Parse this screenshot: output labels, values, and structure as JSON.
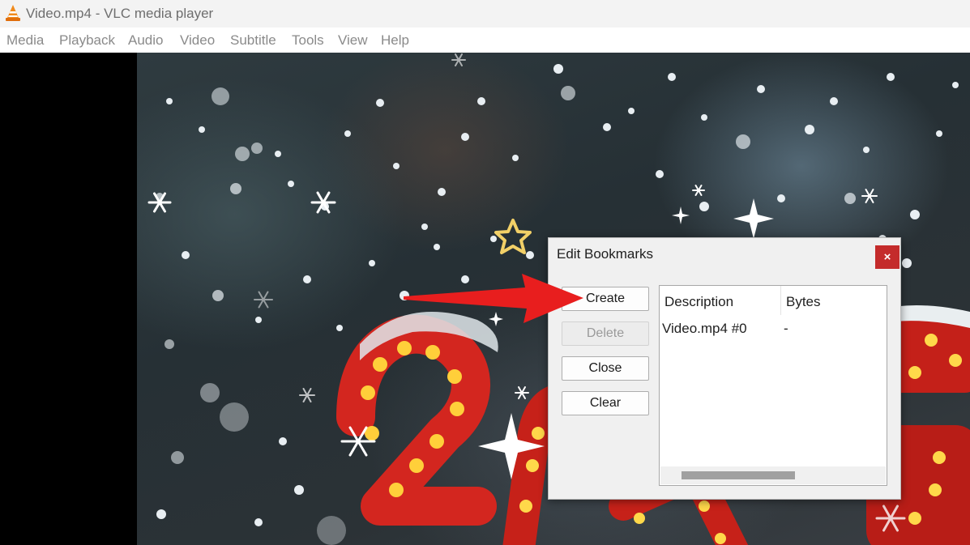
{
  "window": {
    "title": "Video.mp4 - VLC media player",
    "icon": "vlc-cone-icon"
  },
  "menubar": {
    "items": [
      "Media",
      "Playback",
      "Audio",
      "Video",
      "Subtitle",
      "Tools",
      "View",
      "Help"
    ]
  },
  "dialog": {
    "title": "Edit Bookmarks",
    "close_label": "×",
    "buttons": {
      "create": "Create",
      "delete": "Delete",
      "close": "Close",
      "clear": "Clear"
    },
    "table": {
      "headers": [
        "Description",
        "Bytes"
      ],
      "rows": [
        [
          "Video.mp4 #0",
          "-"
        ]
      ]
    }
  },
  "colors": {
    "close_button": "#c42b2b",
    "annotation_arrow": "#e81e1e"
  }
}
